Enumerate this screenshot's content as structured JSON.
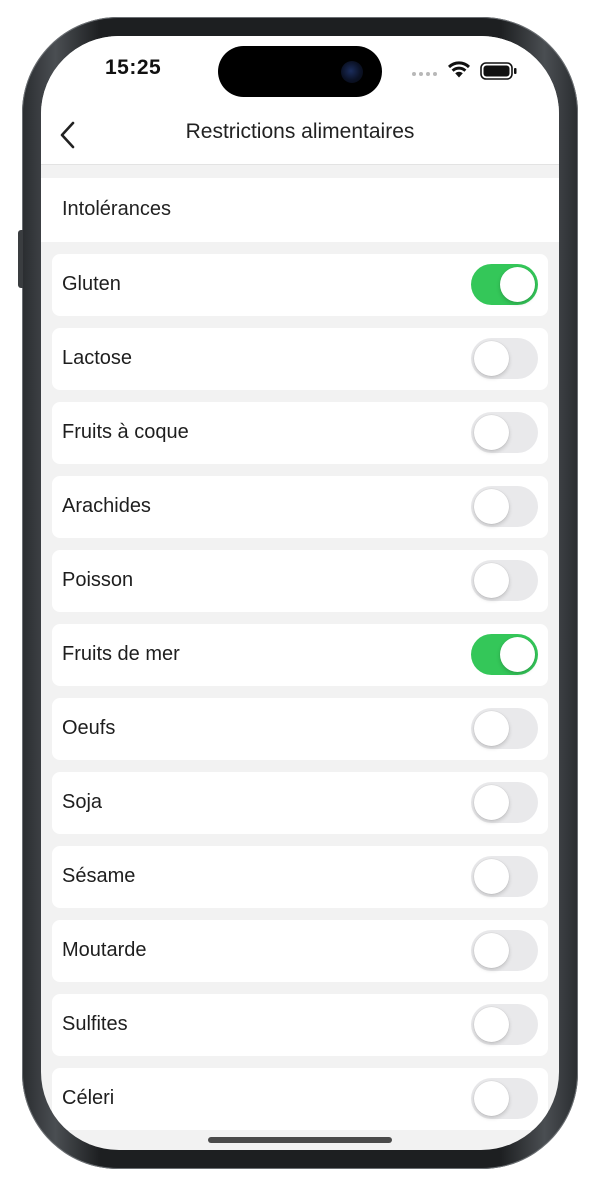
{
  "status": {
    "time": "15:25"
  },
  "nav": {
    "title": "Restrictions alimentaires"
  },
  "section": {
    "title": "Intolérances"
  },
  "colors": {
    "toggle_on": "#34c759",
    "toggle_off": "#e9e9eb"
  },
  "items": [
    {
      "label": "Gluten",
      "enabled": true
    },
    {
      "label": "Lactose",
      "enabled": false
    },
    {
      "label": "Fruits à coque",
      "enabled": false
    },
    {
      "label": "Arachides",
      "enabled": false
    },
    {
      "label": "Poisson",
      "enabled": false
    },
    {
      "label": "Fruits de mer",
      "enabled": true
    },
    {
      "label": "Oeufs",
      "enabled": false
    },
    {
      "label": "Soja",
      "enabled": false
    },
    {
      "label": "Sésame",
      "enabled": false
    },
    {
      "label": "Moutarde",
      "enabled": false
    },
    {
      "label": "Sulfites",
      "enabled": false
    },
    {
      "label": "Céleri",
      "enabled": false
    }
  ]
}
